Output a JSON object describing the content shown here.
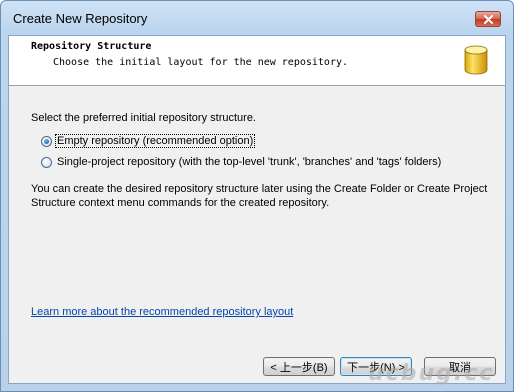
{
  "window": {
    "title": "Create New Repository"
  },
  "header": {
    "title": "Repository Structure",
    "subtitle": "Choose the initial layout for the new repository.",
    "icon": "database-icon"
  },
  "content": {
    "prompt": "Select the preferred initial repository structure.",
    "options": [
      {
        "label": "Empty repository (recommended option)",
        "checked": true
      },
      {
        "label": "Single-project repository (with the top-level 'trunk', 'branches' and 'tags' folders)",
        "checked": false
      }
    ],
    "info_line1": "You can create the desired repository structure later using the Create Folder or Create Project",
    "info_line2": "Structure context menu commands for the created repository.",
    "link": "Learn more about the recommended repository layout"
  },
  "buttons": {
    "back": "< 上一步(B)",
    "next": "下一步(N) >",
    "cancel": "取消"
  },
  "watermark": "ucbug.cc",
  "colors": {
    "titlebar": "#bcd5ee",
    "client_bg": "#f0f0f0",
    "link": "#0645ad",
    "close_button": "#c23b22",
    "db_icon": "#f2c200"
  }
}
